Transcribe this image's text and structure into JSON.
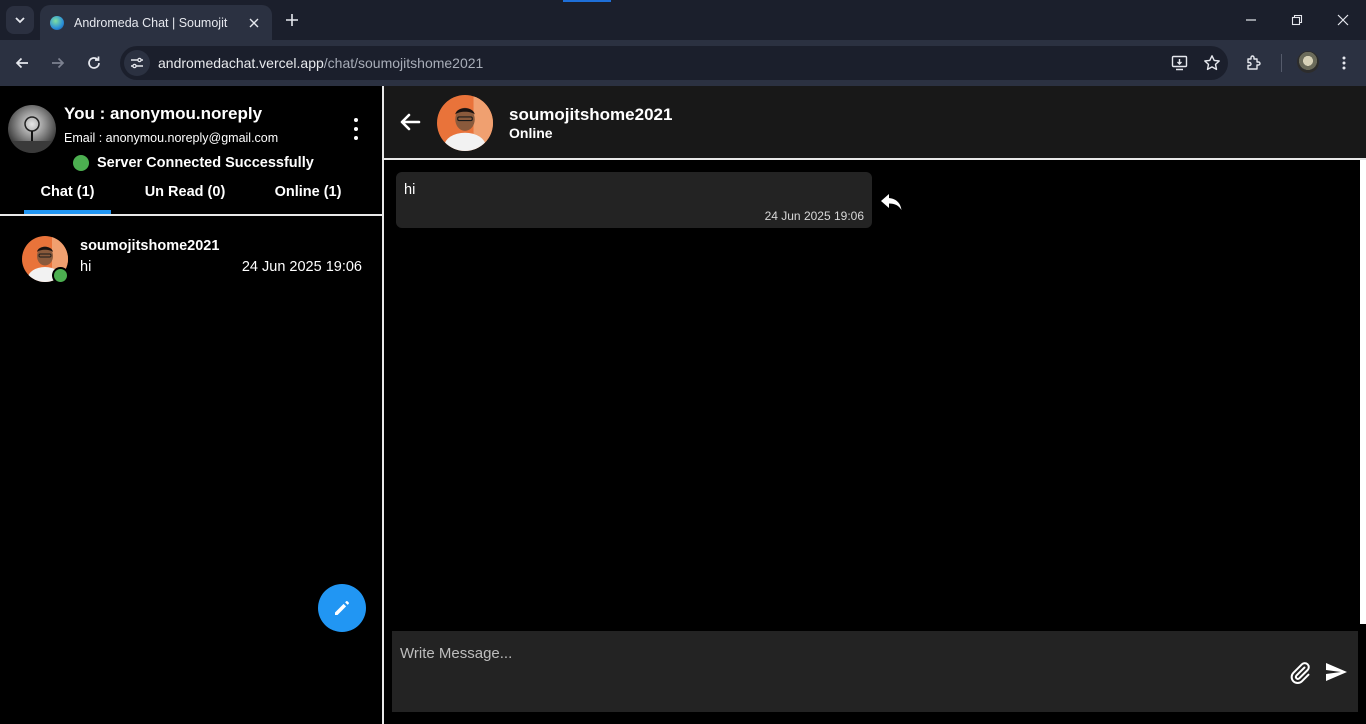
{
  "browser": {
    "tab_title": "Andromeda Chat | Soumojit",
    "url_host": "andromedachat.vercel.app",
    "url_path": "/chat/soumojitshome2021"
  },
  "user": {
    "name_line": "You : anonymou.noreply",
    "email_line": "Email : anonymou.noreply@gmail.com",
    "status_text": "Server Connected Successfully"
  },
  "tabs": [
    {
      "label": "Chat (1)",
      "active": true
    },
    {
      "label": "Un Read (0)",
      "active": false
    },
    {
      "label": "Online (1)",
      "active": false
    }
  ],
  "chat_list": [
    {
      "name": "soumojitshome2021",
      "last_message": "hi",
      "time": "24 Jun 2025 19:06",
      "online": true
    }
  ],
  "conversation": {
    "contact_name": "soumojitshome2021",
    "contact_status": "Online",
    "messages": [
      {
        "text": "hi",
        "time": "24 Jun 2025 19:06"
      }
    ]
  },
  "composer": {
    "placeholder": "Write Message..."
  },
  "colors": {
    "accent": "#2196f3",
    "online": "#4caf50",
    "panel": "#232323",
    "header": "#181818"
  }
}
